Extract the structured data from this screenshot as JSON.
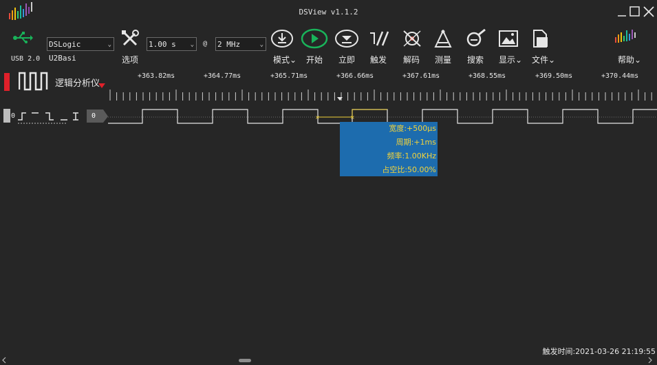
{
  "window": {
    "title": "DSView v1.1.2"
  },
  "toolbar": {
    "device_label": "USB 2.0",
    "device_select": "DSLogic U2Basi",
    "options_label": "选项",
    "time_select": "1.00 s",
    "at_symbol": "@",
    "rate_select": "2 MHz",
    "mode_label": "模式",
    "start_label": "开始",
    "instant_label": "立即",
    "trigger_label": "触发",
    "decode_label": "解码",
    "measure_label": "测量",
    "search_label": "搜索",
    "display_label": "显示",
    "file_label": "文件",
    "help_label": "帮助"
  },
  "channel_panel": {
    "title": "逻辑分析仪",
    "channel_index": "0",
    "channel_name": "0"
  },
  "ruler": {
    "ticks": [
      "+363.82ms",
      "+364.77ms",
      "+365.71ms",
      "+366.66ms",
      "+367.61ms",
      "+368.55ms",
      "+369.50ms",
      "+370.44ms"
    ]
  },
  "measurement": {
    "width": "宽度:+500μs",
    "period": "周期:+1ms",
    "frequency": "频率:1.00KHz",
    "duty": "占空比:50.00%"
  },
  "status": {
    "trigger_time": "触发时间:2021-03-26 21:19:55"
  },
  "colors": {
    "background": "#262626",
    "accent_green": "#19b35a",
    "measure_bg": "#1d6cae",
    "measure_text": "#f3d33a",
    "channel_red": "#e0202a"
  }
}
